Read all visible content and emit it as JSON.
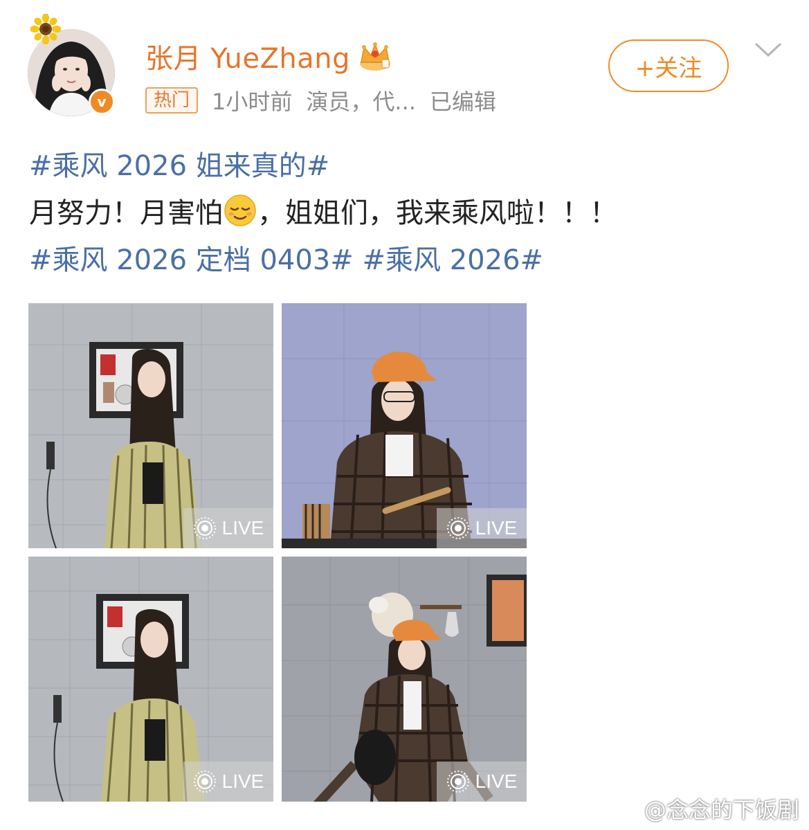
{
  "user": {
    "name": "张月 YueZhang",
    "avatar_icon": "user-avatar-photo",
    "decoration_icon": "sunflower-icon",
    "verified_icon": "verified-v-badge",
    "vip_icon": "crown-icon"
  },
  "meta": {
    "hot_badge": "热门",
    "time": "1小时前",
    "source": "演员，代...",
    "edited": "已编辑"
  },
  "actions": {
    "follow_label": "+关注",
    "more_icon": "chevron-down-icon"
  },
  "post": {
    "line1": {
      "hashtag": "#乘风 2026 姐来真的#"
    },
    "line2": {
      "text_before": "月努力！月害怕",
      "emoji": "relieved-face-emoji",
      "text_after": "，姐姐们，我来乘风啦！！！"
    },
    "line3": {
      "hashtag1": "#乘风 2026 定档 0403#",
      "hashtag2": "#乘风 2026#"
    }
  },
  "photos": [
    {
      "live_label": "LIVE",
      "description_icon": "photo-striped-shirt"
    },
    {
      "live_label": "LIVE",
      "description_icon": "photo-drumsticks"
    },
    {
      "live_label": "LIVE",
      "description_icon": "photo-striped-shirt-2"
    },
    {
      "live_label": "LIVE",
      "description_icon": "photo-plaid-shirt"
    }
  ],
  "watermark": {
    "text": "@念念的下饭剧",
    "icon": "weibo-logo-icon"
  },
  "colors": {
    "accent_orange": "#f08a24",
    "username_orange": "#e8742a",
    "hashtag_blue": "#4a6fa5",
    "meta_gray": "#8c8c8c"
  }
}
